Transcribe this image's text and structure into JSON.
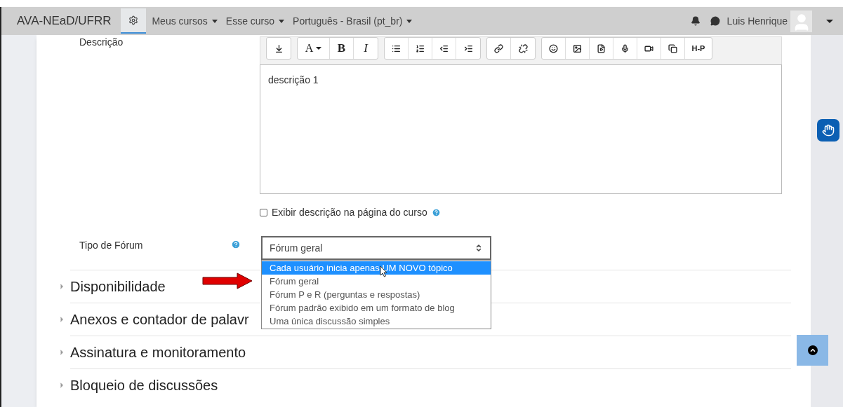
{
  "navbar": {
    "brand": "AVA-NEaD/UFRR",
    "menus": [
      {
        "label": "Meus cursos"
      },
      {
        "label": "Esse curso"
      },
      {
        "label": "Português - Brasil (pt_br)"
      }
    ],
    "user": "Luis Henrique"
  },
  "description": {
    "label": "Descrição",
    "toolbar": [
      [
        {
          "kind": "expand"
        }
      ],
      [
        {
          "kind": "text-menu",
          "label": "A"
        },
        {
          "kind": "bold",
          "label": "B"
        },
        {
          "kind": "italic",
          "label": "I"
        }
      ],
      [
        {
          "kind": "bullets"
        },
        {
          "kind": "numbers"
        },
        {
          "kind": "outdent"
        },
        {
          "kind": "indent"
        }
      ],
      [
        {
          "kind": "link"
        },
        {
          "kind": "unlink"
        }
      ],
      [
        {
          "kind": "emoji"
        },
        {
          "kind": "image"
        },
        {
          "kind": "media"
        },
        {
          "kind": "mic"
        },
        {
          "kind": "video"
        },
        {
          "kind": "copy"
        },
        {
          "kind": "logo",
          "label": "H-P"
        }
      ]
    ],
    "value": "descrição 1",
    "show_on_course": {
      "label": "Exibir descrição na página do curso",
      "checked": false
    }
  },
  "forum_type": {
    "label": "Tipo de Fórum",
    "value": "Fórum geral",
    "options": [
      {
        "label": "Cada usuário inicia apenas UM NOVO tópico",
        "highlighted": true
      },
      {
        "label": "Fórum geral",
        "highlighted": false
      },
      {
        "label": "Fórum P e R (perguntas e respostas)",
        "highlighted": false
      },
      {
        "label": "Fórum padrão exibido em um formato de blog",
        "highlighted": false
      },
      {
        "label": "Uma única discussão simples",
        "highlighted": false
      }
    ]
  },
  "sections": [
    {
      "title": "Disponibilidade",
      "expanded": false
    },
    {
      "title": "Anexos e contador de palavr",
      "expanded": false
    },
    {
      "title": "Assinatura e monitoramento",
      "expanded": false
    },
    {
      "title": "Bloqueio de discussões",
      "expanded": false
    }
  ]
}
